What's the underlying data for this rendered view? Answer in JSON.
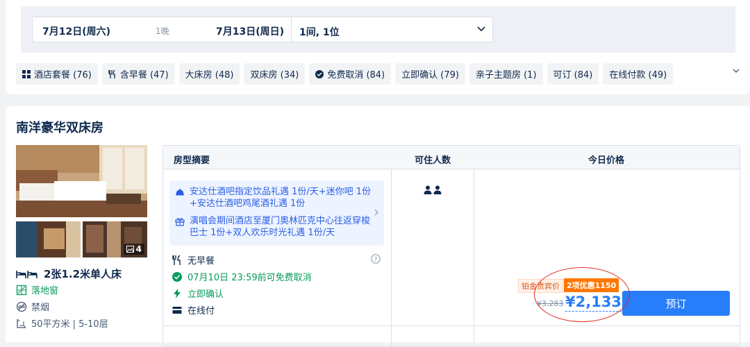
{
  "search": {
    "checkin": "7月12日(周六)",
    "nights": "1晚",
    "checkout": "7月13日(周日)",
    "guests": "1间, 1位"
  },
  "filters": [
    {
      "label": "酒店套餐 (76)",
      "icon": "grid-icon"
    },
    {
      "label": "含早餐 (47)",
      "icon": "fork-knife-icon"
    },
    {
      "label": "大床房 (48)",
      "icon": ""
    },
    {
      "label": "双床房 (34)",
      "icon": ""
    },
    {
      "label": "免费取消 (84)",
      "icon": "check-circle-icon"
    },
    {
      "label": "立即确认 (79)",
      "icon": ""
    },
    {
      "label": "亲子主题房 (1)",
      "icon": ""
    },
    {
      "label": "可订 (84)",
      "icon": ""
    },
    {
      "label": "在线付款 (49)",
      "icon": ""
    }
  ],
  "room": {
    "title": "南洋豪华双床房",
    "photo_count": "4",
    "bed": "2张1.2米单人床",
    "window": "落地窗",
    "smoking": "禁烟",
    "size": "50平方米 | 5-10层"
  },
  "table": {
    "headers": [
      "房型摘要",
      "可住人数",
      "今日价格"
    ],
    "perks": [
      "安达仕酒吧指定饮品礼遇 1份/天+迷你吧 1份+安达仕酒吧鸡尾酒礼遇 1份",
      "演唱会期间酒店至厦门奥林匹克中心往返穿梭巴士 1份+双人欢乐时光礼遇 1份/天"
    ],
    "breakfast": "无早餐",
    "cancel": "07月10日 23:59前可免费取消",
    "confirm": "立即确认",
    "payment": "在线付",
    "member_badge": "铂金贵宾价",
    "promo_badge": "2项优惠1150",
    "original_price": "¥3,283",
    "price": "¥2,133",
    "book_label": "预订"
  },
  "colors": {
    "accent": "#287dfa",
    "green": "#0a9a5a",
    "promo": "#ff7700",
    "annotation": "#e0271f"
  }
}
